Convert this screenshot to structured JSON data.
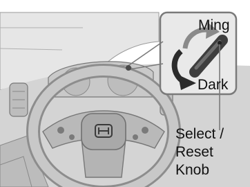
{
  "labels": {
    "brighten": "Ming",
    "darken": "Dark",
    "knob_lines": [
      "Select /",
      "Reset",
      "Knob"
    ]
  },
  "colors": {
    "background": "#ffffff",
    "dashboard": "#d8d8d8",
    "linework": "#6a6a6a",
    "callout_fill": "#e9e9e9",
    "arrow_light": "#8a8a8a",
    "arrow_dark": "#2b2b2b",
    "knob": "#4a4a4a",
    "text": "#111111"
  },
  "icons": {
    "brighten_arrow": "curved-arrow-clockwise-icon",
    "darken_arrow": "curved-arrow-counterclockwise-icon",
    "knob": "select-reset-knob-icon",
    "logo": "steering-wheel-emblem-icon"
  }
}
